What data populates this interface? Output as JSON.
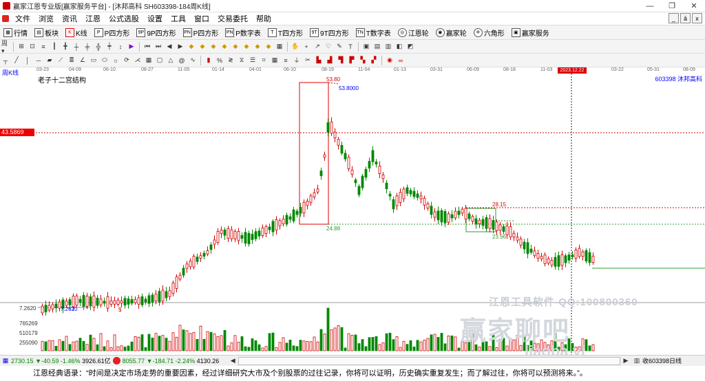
{
  "window": {
    "title": "赢家江恩专业版[赢家服务平台] - [沐邦高科  SH603398-184周K线]",
    "controls": [
      "—",
      "❐",
      "✕"
    ]
  },
  "menu": [
    "文件",
    "浏览",
    "资讯",
    "江恩",
    "公式选股",
    "设置",
    "工具",
    "窗口",
    "交易委托",
    "帮助"
  ],
  "mdi_controls": [
    "_",
    "ā",
    "x"
  ],
  "toolbar1": [
    {
      "label": "行情",
      "icon": "grid-icon"
    },
    {
      "label": "板块",
      "icon": "blocks-icon"
    },
    {
      "label": "K线",
      "icon": "kline-icon"
    },
    {
      "label": "P四方形",
      "icon": "p-square-icon"
    },
    {
      "label": "9P四方形",
      "icon": "9p-square-icon"
    },
    {
      "label": "P四方形",
      "icon": "pn-square-icon"
    },
    {
      "label": "P数字表",
      "icon": "p-table-icon"
    },
    {
      "label": "T四方形",
      "icon": "t-square-icon"
    },
    {
      "label": "9T四方形",
      "icon": "9t-square-icon"
    },
    {
      "label": "T数字表",
      "icon": "t-table-icon"
    },
    {
      "label": "江恩轮",
      "icon": "gann-wheel-icon"
    },
    {
      "label": "赢家轮",
      "icon": "winner-wheel-icon"
    },
    {
      "label": "六角形",
      "icon": "hexagon-icon"
    },
    {
      "label": "赢家服务",
      "icon": "service-icon"
    }
  ],
  "dates": [
    "03-23",
    "04-09",
    "06-10",
    "08-27",
    "11-05",
    "01-14",
    "04-01",
    "06-10",
    "08-19",
    "11-04",
    "01-13",
    "03-31",
    "06-09",
    "08-18",
    "11-03",
    "03-22",
    "05-31",
    "08-09"
  ],
  "highlight_date": "2023.12.22",
  "chart": {
    "period_label": "周K线",
    "indicator_name": "老子十二宫结构",
    "stock_label": "603398  沐邦高科",
    "current_price": "43.5869",
    "high_label": "53.80",
    "high_label2": "53.8000",
    "box_low_label": "24.88",
    "level1": "28.15",
    "level2": "23.96",
    "low_label": "7.2620",
    "low_label2": "7.2620",
    "dollar": "$"
  },
  "volume_axis": [
    "765269",
    "510179",
    "255090"
  ],
  "watermark": {
    "line1": "江恩工具软件  QQ:100800360",
    "line2": "赢家聊吧",
    "line3": "ljaoba.yj"
  },
  "statusbar": {
    "sh_index": "2730.15",
    "sh_change": "▼-40.59",
    "sh_pct": "-1.46%",
    "sh_amount": "3926.61亿",
    "sz_index": "8055.77",
    "sz_change": "▼-184.71",
    "sz_pct": "-2.24%",
    "sz_amount": "4130.26",
    "right_text": "收603398日线"
  },
  "quote": "江恩经典语录：“时间是决定市场走势的重要因素，经过详细研究大市及个别股票的过往记录，你将可以证明，历史确实重复发生；而了解过往，你将可以预测将来。”。",
  "colors": {
    "up": "#d00000",
    "down": "#008800",
    "accent": "#0000ff",
    "price_tag": "#e00000"
  }
}
